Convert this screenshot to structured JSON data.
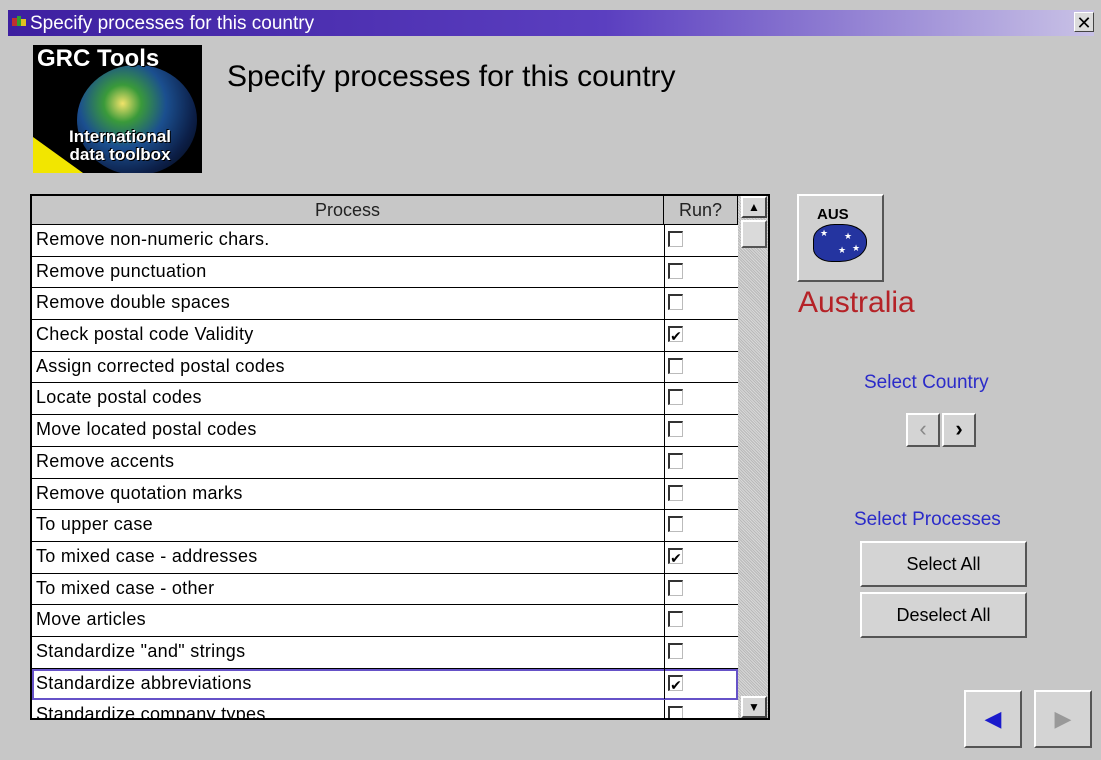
{
  "window": {
    "title": "Specify processes for this country",
    "close_glyph": "✕"
  },
  "logo": {
    "line1": "GRC Tools",
    "line2": "International",
    "line3": "data toolbox"
  },
  "heading": "Specify processes for this country",
  "grid": {
    "columns": {
      "process": "Process",
      "run": "Run?"
    },
    "rows": [
      {
        "name": "Remove non-numeric chars.",
        "run": false
      },
      {
        "name": "Remove punctuation",
        "run": false
      },
      {
        "name": "Remove double spaces",
        "run": false
      },
      {
        "name": "Check postal code Validity",
        "run": true
      },
      {
        "name": "Assign corrected postal codes",
        "run": false
      },
      {
        "name": "Locate postal codes",
        "run": false
      },
      {
        "name": "Move located postal codes",
        "run": false
      },
      {
        "name": "Remove accents",
        "run": false
      },
      {
        "name": "Remove quotation marks",
        "run": false
      },
      {
        "name": "To upper case",
        "run": false
      },
      {
        "name": "To mixed case - addresses",
        "run": true
      },
      {
        "name": "To mixed case - other",
        "run": false
      },
      {
        "name": "Move articles",
        "run": false
      },
      {
        "name": "Standardize \"and\" strings",
        "run": false
      },
      {
        "name": "Standardize abbreviations",
        "run": true,
        "selected": true
      },
      {
        "name": "Standardize company types",
        "run": false
      }
    ],
    "scroll_up": "▲",
    "scroll_down": "▼"
  },
  "country": {
    "code": "AUS",
    "name": "Australia"
  },
  "select_country": {
    "label": "Select Country",
    "prev": "‹",
    "next": "›"
  },
  "select_processes": {
    "label": "Select Processes",
    "select_all": "Select All",
    "deselect_all": "Deselect All"
  },
  "page_nav": {
    "back": "◀",
    "forward": "▶"
  },
  "colors": {
    "accent_blue": "#2b2bc9",
    "country_red": "#b52227",
    "title_bar": "#3d1fa0"
  }
}
